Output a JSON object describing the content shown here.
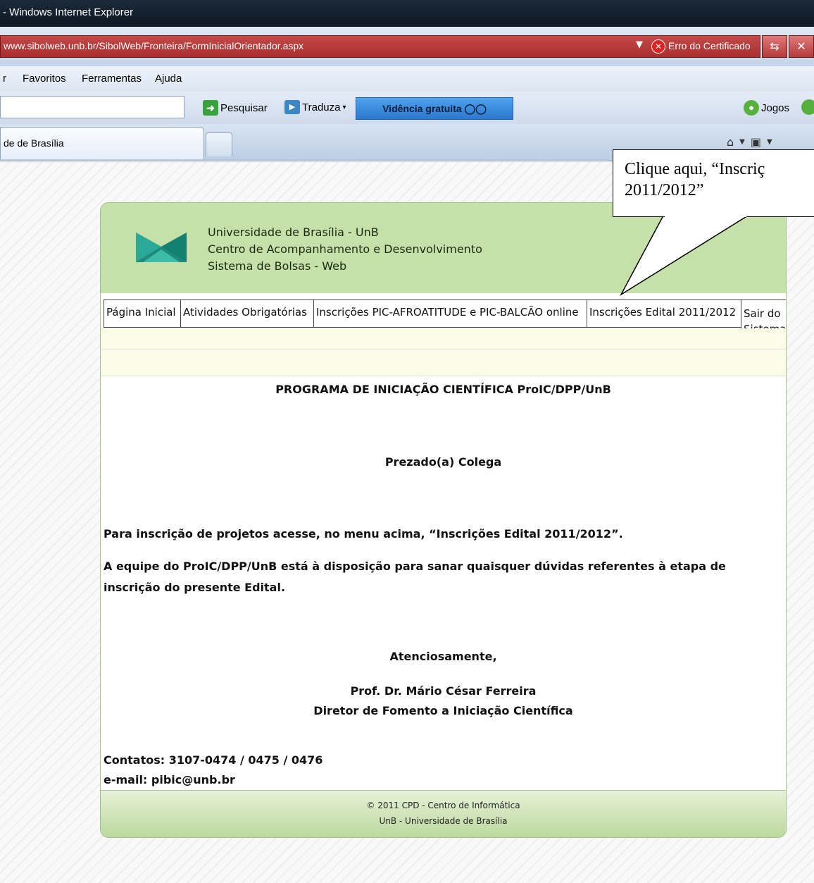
{
  "window": {
    "title": "- Windows Internet Explorer"
  },
  "address": {
    "url": "www.sibolweb.unb.br/SibolWeb/Fronteira/FormInicialOrientador.aspx",
    "certificate": "Erro do Certificado"
  },
  "menu": {
    "items": [
      "r",
      "Favoritos",
      "Ferramentas",
      "Ajuda"
    ]
  },
  "toolbar": {
    "search_label": "Pesquisar",
    "translate_label": "Traduza",
    "promo_label": "Vidência gratuita",
    "games_label": "Jogos"
  },
  "tab": {
    "title": "de de Brasília"
  },
  "header": {
    "line1": "Universidade de Brasília - UnB",
    "line2": "Centro de Acompanhamento e Desenvolvimento",
    "line3": "Sistema de Bolsas - Web"
  },
  "nav": {
    "home": "Página Inicial",
    "activities": "Atividades Obrigatórias",
    "pic": "Inscrições PIC-AFROATITUDE e PIC-BALCÃO online",
    "edital": "Inscrições Edital 2011/2012",
    "logout": "Sair do Sistema"
  },
  "content": {
    "title": "PROGRAMA DE INICIAÇÃO CIENTÍFICA ProIC/DPP/UnB",
    "greeting": "Prezado(a) Colega",
    "para1": "Para inscrição de projetos acesse, no menu acima, “Inscrições Edital 2011/2012”.",
    "para2": "A equipe do ProIC/DPP/UnB está à disposição para sanar quaisquer dúvidas referentes à etapa de inscrição do presente Edital.",
    "closing": "Atenciosamente,",
    "signer": "Prof. Dr. Mário César Ferreira",
    "role": "Diretor de Fomento a Iniciação Científica",
    "contacts": "Contatos: 3107-0474 / 0475 / 0476",
    "email": "e-mail: pibic@unb.br"
  },
  "footer": {
    "line1": "© 2011 CPD - Centro de Informática",
    "line2": "UnB - Universidade de Brasília"
  },
  "callout": {
    "line1": "Clique aqui, “Inscriç",
    "line2": "2011/2012”"
  }
}
